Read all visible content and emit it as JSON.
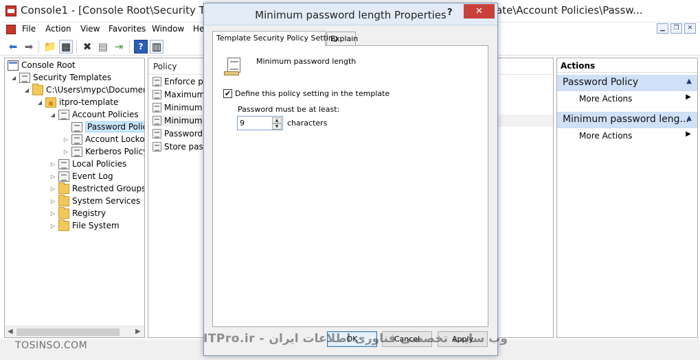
{
  "main_window": {
    "title_left": "Console1 - [Console Root\\Security Temp",
    "title_right": "ate\\Account Policies\\Passw..."
  },
  "menu": [
    "File",
    "Action",
    "View",
    "Favorites",
    "Window",
    "He"
  ],
  "mdi_buttons": [
    "minimize",
    "restore",
    "close"
  ],
  "tree": [
    {
      "label": "Console Root",
      "icon": "console-icon",
      "level": 0,
      "twisty": ""
    },
    {
      "label": "Security Templates",
      "icon": "security-templates-icon",
      "level": 1,
      "twisty": "◢"
    },
    {
      "label": "C:\\Users\\mypc\\Document",
      "icon": "folder-icon",
      "level": 2,
      "twisty": "◢"
    },
    {
      "label": "itpro-template",
      "icon": "template-icon",
      "level": 3,
      "twisty": "◢"
    },
    {
      "label": "Account Policies",
      "icon": "policy-icon",
      "level": 4,
      "twisty": "◢"
    },
    {
      "label": "Password Policy",
      "icon": "policy-icon",
      "level": 5,
      "twisty": "",
      "selected": true
    },
    {
      "label": "Account Lockou",
      "icon": "policy-icon",
      "level": 5,
      "twisty": "▷"
    },
    {
      "label": "Kerberos Policy",
      "icon": "policy-icon",
      "level": 5,
      "twisty": "▷"
    },
    {
      "label": "Local Policies",
      "icon": "policy-icon",
      "level": 4,
      "twisty": "▷"
    },
    {
      "label": "Event Log",
      "icon": "policy-icon",
      "level": 4,
      "twisty": "▷"
    },
    {
      "label": "Restricted Groups",
      "icon": "folder-icon",
      "level": 4,
      "twisty": "▷"
    },
    {
      "label": "System Services",
      "icon": "folder-icon",
      "level": 4,
      "twisty": "▷"
    },
    {
      "label": "Registry",
      "icon": "folder-icon",
      "level": 4,
      "twisty": "▷"
    },
    {
      "label": "File System",
      "icon": "folder-icon",
      "level": 4,
      "twisty": "▷"
    }
  ],
  "center": {
    "column_header": "Policy",
    "rows": [
      {
        "label": "Enforce pa"
      },
      {
        "label": "Maximum"
      },
      {
        "label": "Minimum"
      },
      {
        "label": "Minimum",
        "selected": true
      },
      {
        "label": "Password r"
      },
      {
        "label": "Store passv"
      }
    ]
  },
  "actions": {
    "title": "Actions",
    "sections": [
      {
        "title": "Password Policy",
        "item": "More Actions"
      },
      {
        "title": "Minimum password leng...",
        "item": "More Actions"
      }
    ]
  },
  "dialog": {
    "title": "Minimum password length Properties",
    "help_glyph": "?",
    "close_glyph": "✕",
    "tabs": [
      "Template Security Policy Setting",
      "Explain"
    ],
    "policy_name": "Minimum password length",
    "checkbox_label": "Define this policy setting in the template",
    "checkbox_checked": true,
    "min_label": "Password must be at least:",
    "value": "9",
    "units": "characters",
    "buttons": {
      "ok": "OK",
      "cancel": "Cancel",
      "apply": "Apply"
    }
  },
  "watermarks": {
    "left": "TOSINSO.COM",
    "bottom": "ITPro.ir - وب سایت تخصصی فناوری اطلاعات ایران"
  }
}
